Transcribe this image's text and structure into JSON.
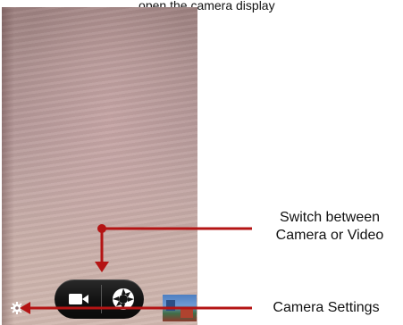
{
  "caption": {
    "top_text": "...open the camera display"
  },
  "camera": {
    "controls": {
      "video_icon": "video-camera-icon",
      "shutter_icon": "shutter-aperture-icon",
      "settings_icon": "gear-icon"
    },
    "thumbnail": "gallery-thumbnail"
  },
  "annotations": {
    "switch_line1": "Switch between",
    "switch_line2": "Camera or Video",
    "settings": "Camera Settings"
  },
  "colors": {
    "annotation_red": "#b41414",
    "control_bar": "#141414",
    "icon_white": "#ffffff"
  }
}
